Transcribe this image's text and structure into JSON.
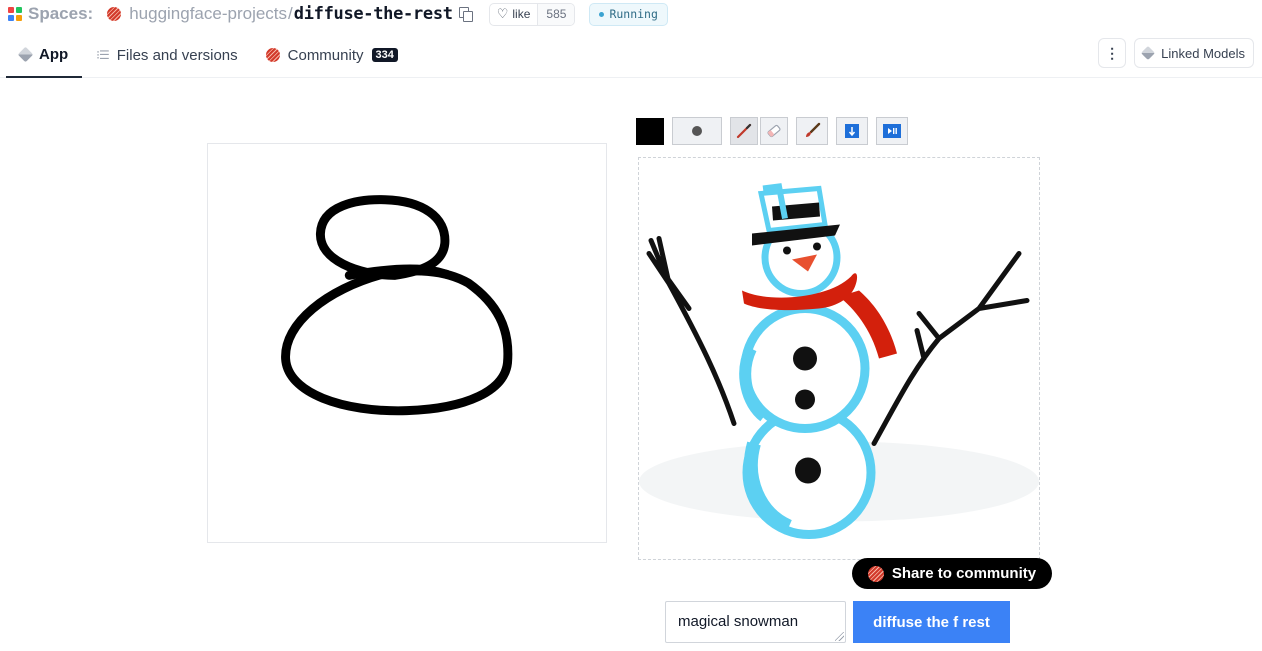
{
  "header": {
    "spaces_label": "Spaces:",
    "org_name": "huggingface-projects",
    "separator": "/",
    "repo_name": "diffuse-the-rest",
    "like_label": "like",
    "like_count": "585",
    "status": "Running"
  },
  "tabs": [
    {
      "label": "App",
      "icon": "app-icon",
      "active": true
    },
    {
      "label": "Files and versions",
      "icon": "files-icon",
      "active": false
    },
    {
      "label": "Community",
      "icon": "hf-icon",
      "badge": "334",
      "active": false
    }
  ],
  "header_actions": {
    "more_label": "⋮",
    "linked_models_label": "Linked Models"
  },
  "canvas_toolbar": {
    "brush_color": "#000000",
    "tools": [
      "stroke-size-icon",
      "pencil-icon",
      "eraser-icon",
      "brush-icon",
      "download-icon",
      "play-icon"
    ]
  },
  "share_button_label": "Share to community",
  "prompt": {
    "value": "magical snowman"
  },
  "submit_label": "diffuse the f rest",
  "colors": {
    "accent_blue": "#3b82f6",
    "status_blue": "#3ba3d1",
    "snowman_outline": "#5cd0f2",
    "scarf_red": "#d3200c"
  }
}
